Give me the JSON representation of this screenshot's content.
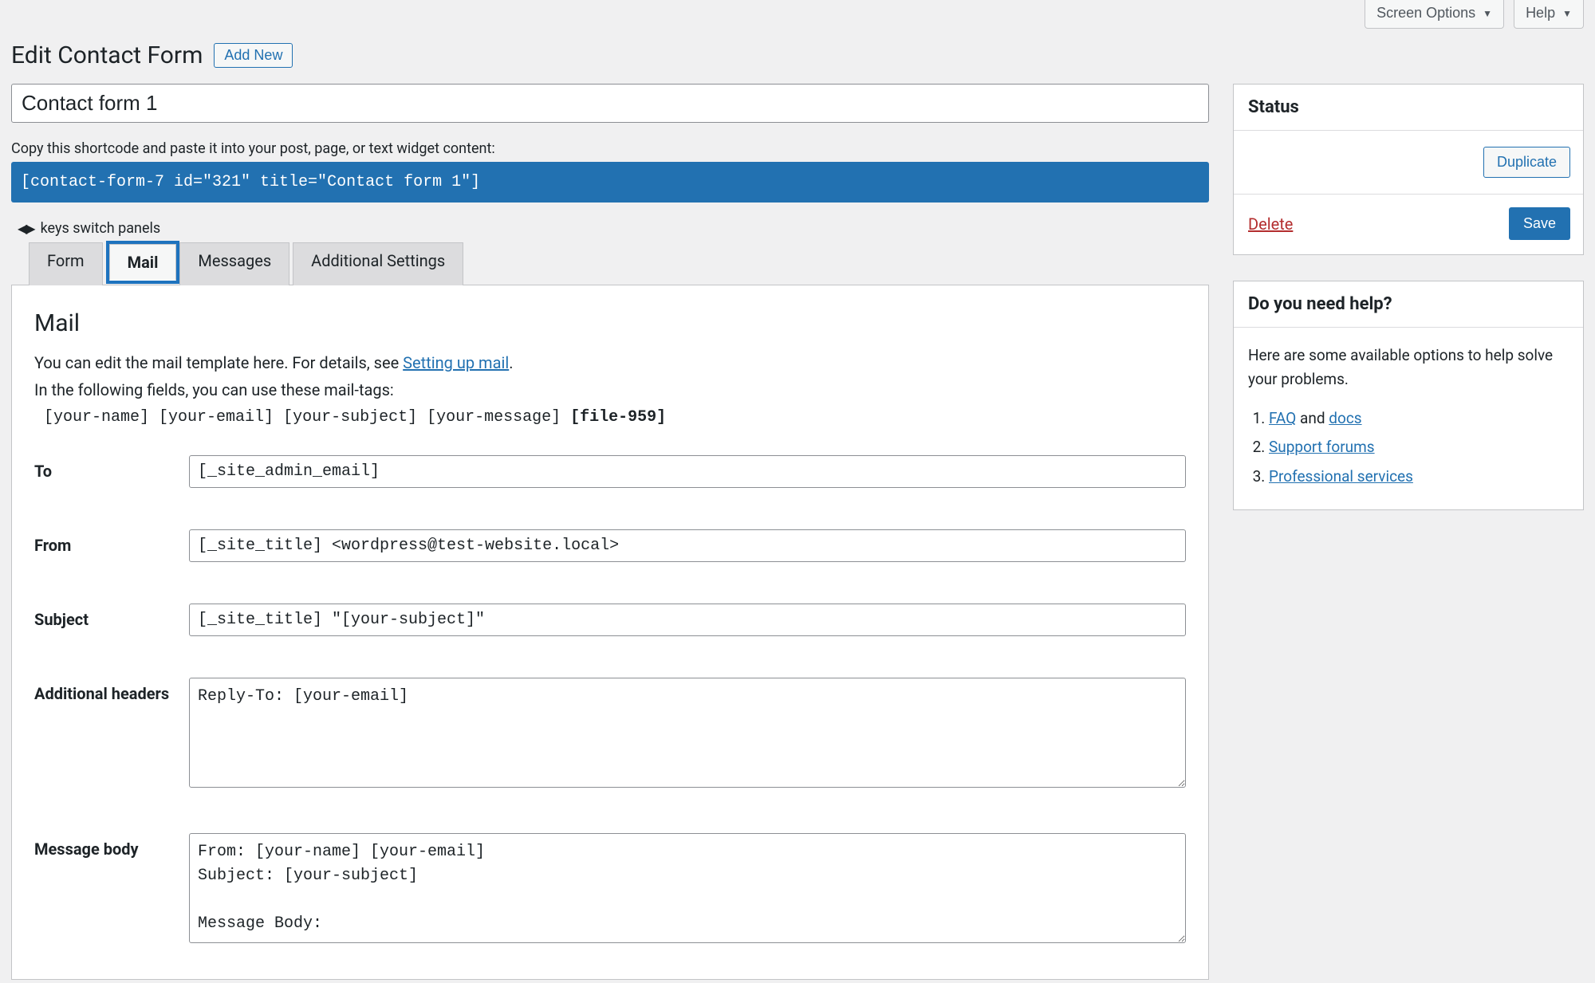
{
  "topbar": {
    "screen_options": "Screen Options",
    "help": "Help"
  },
  "header": {
    "title": "Edit Contact Form",
    "add_new": "Add New"
  },
  "form_title": "Contact form 1",
  "shortcode": {
    "label": "Copy this shortcode and paste it into your post, page, or text widget content:",
    "value": "[contact-form-7 id=\"321\" title=\"Contact form 1\"]"
  },
  "keys_hint": "keys switch panels",
  "tabs": {
    "form": "Form",
    "mail": "Mail",
    "messages": "Messages",
    "additional": "Additional Settings"
  },
  "mail_panel": {
    "heading": "Mail",
    "desc1": "You can edit the mail template here. For details, see ",
    "desc1_link": "Setting up mail",
    "desc2": "In the following fields, you can use these mail-tags:",
    "tags_normal": "[your-name] [your-email] [your-subject] [your-message] ",
    "tags_bold": "[file-959]",
    "fields": {
      "to_label": "To",
      "to_value": "[_site_admin_email]",
      "from_label": "From",
      "from_value": "[_site_title] <wordpress@test-website.local>",
      "subject_label": "Subject",
      "subject_value": "[_site_title] \"[your-subject]\"",
      "headers_label": "Additional headers",
      "headers_value": "Reply-To: [your-email]",
      "body_label": "Message body",
      "body_value": "From: [your-name] [your-email]\nSubject: [your-subject]\n\nMessage Body:"
    }
  },
  "status_box": {
    "title": "Status",
    "duplicate": "Duplicate",
    "delete": "Delete",
    "save": "Save"
  },
  "help_box": {
    "title": "Do you need help?",
    "intro": "Here are some available options to help solve your problems.",
    "faq": "FAQ",
    "and": " and ",
    "docs": "docs",
    "forums": "Support forums",
    "services": "Professional services"
  }
}
